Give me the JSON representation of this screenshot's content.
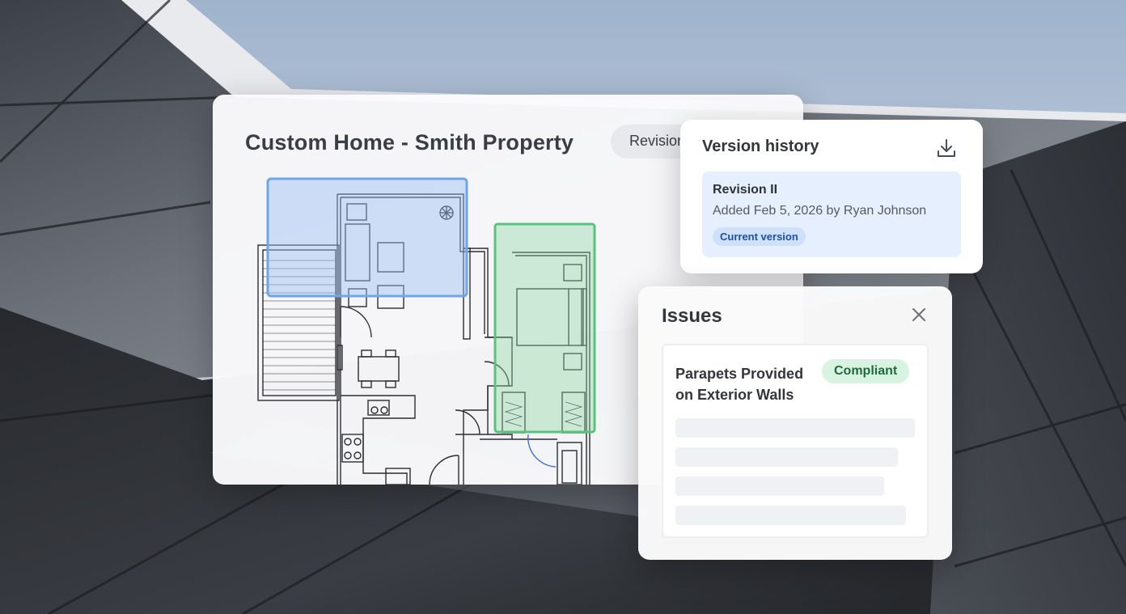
{
  "project": {
    "title": "Custom Home - Smith Property",
    "revision_pill": "Revision II"
  },
  "version_history": {
    "title": "Version history",
    "download_icon": "download-icon",
    "current": {
      "name": "Revision II",
      "meta": "Added Feb 5, 2026 by Ryan Johnson",
      "badge": "Current version"
    }
  },
  "issues": {
    "title": "Issues",
    "close_icon": "close-icon",
    "items": [
      {
        "text": "Parapets Provided on Exterior Walls",
        "status": "Compliant"
      }
    ]
  },
  "colors": {
    "highlight_blue": "#6fa4ee",
    "highlight_green": "#5bc27e",
    "current_badge": "#cfe0fb",
    "compliant_badge": "#d9f3e3"
  }
}
